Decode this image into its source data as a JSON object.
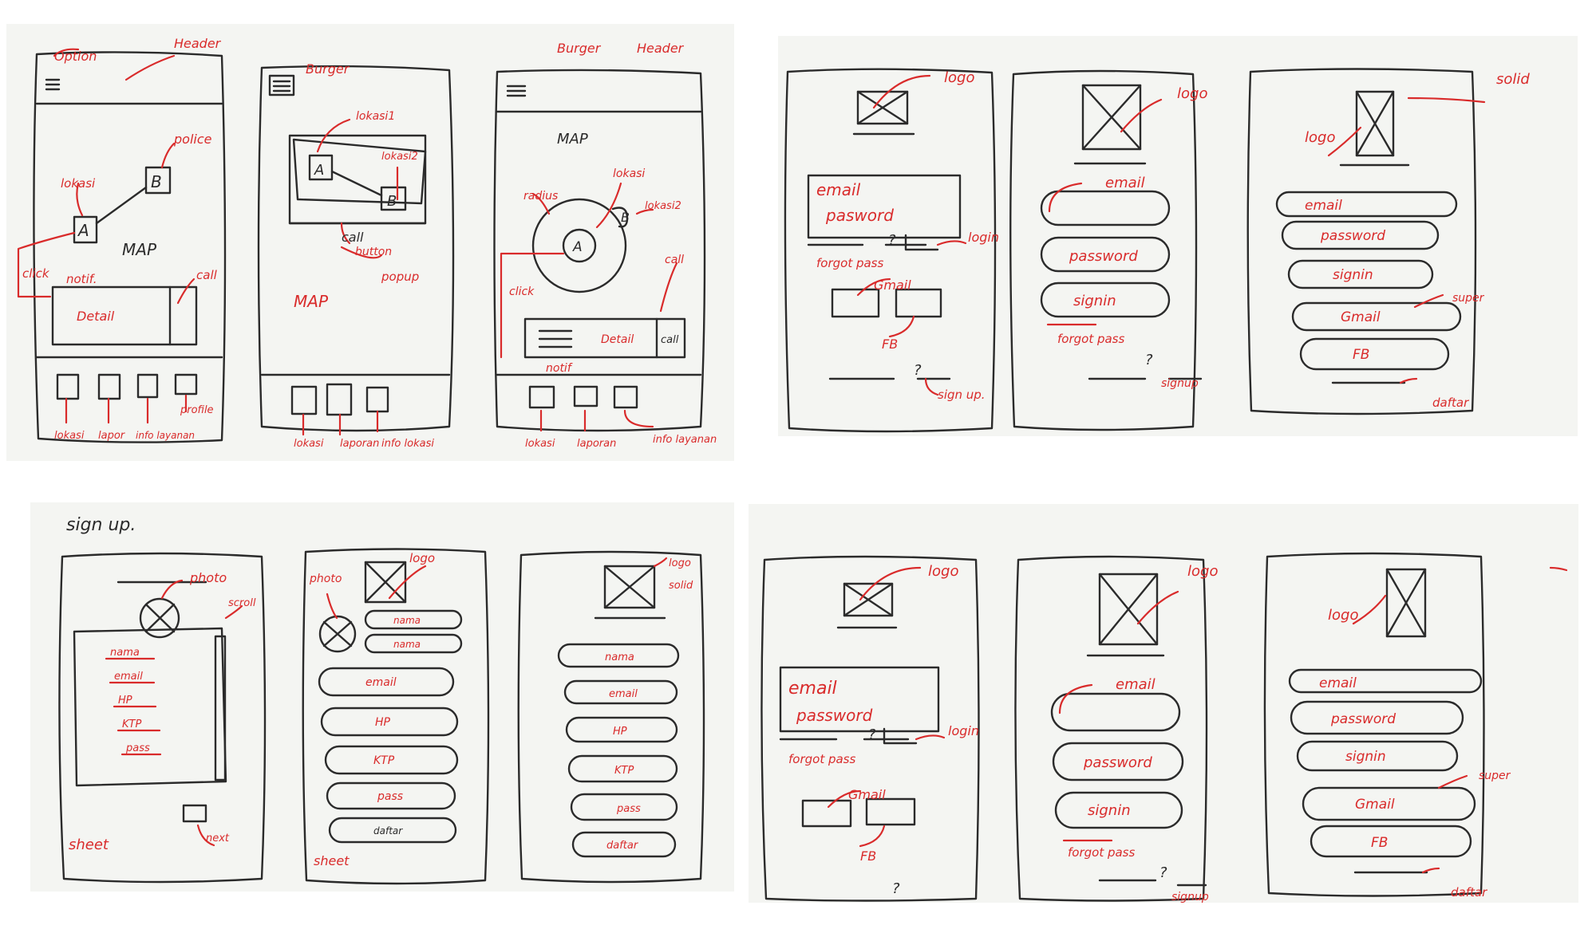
{
  "panel1": {
    "screen1": {
      "labels": {
        "option": "Option",
        "header": "Header",
        "police": "police",
        "lokasi": "lokasi",
        "b": "B",
        "a": "A",
        "map": "MAP",
        "click": "click",
        "notif": "notif.",
        "detail": "Detail",
        "call": "call",
        "nav1": "lokasi",
        "nav2": "lapor",
        "nav3": "info layanan",
        "nav4": "profile"
      }
    },
    "screen2": {
      "labels": {
        "burger": "Burger",
        "lokasi1": "lokasi1",
        "lokasi2": "lokasi2",
        "a": "A",
        "b": "B",
        "call": "call",
        "button": "button",
        "popup": "popup",
        "map": "MAP",
        "nav1": "lokasi",
        "nav2": "laporan",
        "nav3": "info lokasi"
      }
    },
    "screen3": {
      "labels": {
        "burger": "Burger",
        "header": "Header",
        "map": "MAP",
        "radius": "radius",
        "lokasi": "lokasi",
        "lokasi2": "lokasi2",
        "a": "A",
        "b": "B",
        "click": "click",
        "detail": "Detail",
        "call_btn": "call",
        "call": "call",
        "notif": "notif",
        "nav1": "lokasi",
        "nav2": "laporan",
        "nav3": "info layanan"
      }
    }
  },
  "panel2": {
    "screen1": {
      "logo": "logo",
      "email": "email",
      "password": "pasword",
      "forgot": "forgot pass",
      "login": "login",
      "gmail": "Gmail",
      "fb": "FB",
      "signup": "sign up."
    },
    "screen2": {
      "logo": "logo",
      "email": "email",
      "password": "password",
      "signin": "signin",
      "forgot": "forgot pass",
      "signup": "signup"
    },
    "screen3": {
      "logo": "logo",
      "solid": "solid",
      "email": "email",
      "password": "password",
      "signin": "signin",
      "gmail": "Gmail",
      "fb": "FB",
      "super": "super",
      "daftar": "daftar"
    }
  },
  "panel3": {
    "title": "sign up.",
    "screen1": {
      "photo": "photo",
      "scroll": "scroll",
      "f1": "nama",
      "f2": "email",
      "f3": "HP",
      "f4": "KTP",
      "f5": "pass",
      "next": "next",
      "sheet": "sheet"
    },
    "screen2": {
      "photo": "photo",
      "logo": "logo",
      "f1": "nama",
      "f2": "nama",
      "f3": "email",
      "f4": "HP",
      "f5": "KTP",
      "f6": "pass",
      "f7": "daftar",
      "sheet": "sheet"
    },
    "screen3": {
      "logo": "logo",
      "solid": "solid",
      "f1": "nama",
      "f2": "email",
      "f3": "HP",
      "f4": "KTP",
      "f5": "pass",
      "f6": "daftar"
    }
  },
  "panel4": {
    "screen1": {
      "logo": "logo",
      "email": "email",
      "password": "password",
      "forgot": "forgot pass",
      "login": "login",
      "gmail": "Gmail",
      "fb": "FB"
    },
    "screen2": {
      "logo": "logo",
      "email": "email",
      "password": "password",
      "signin": "signin",
      "forgot": "forgot pass",
      "signup": "signup"
    },
    "screen3": {
      "logo": "logo",
      "email": "email",
      "password": "password",
      "signin": "signin",
      "gmail": "Gmail",
      "fb": "FB",
      "super": "super",
      "daftar": "daftar"
    }
  }
}
